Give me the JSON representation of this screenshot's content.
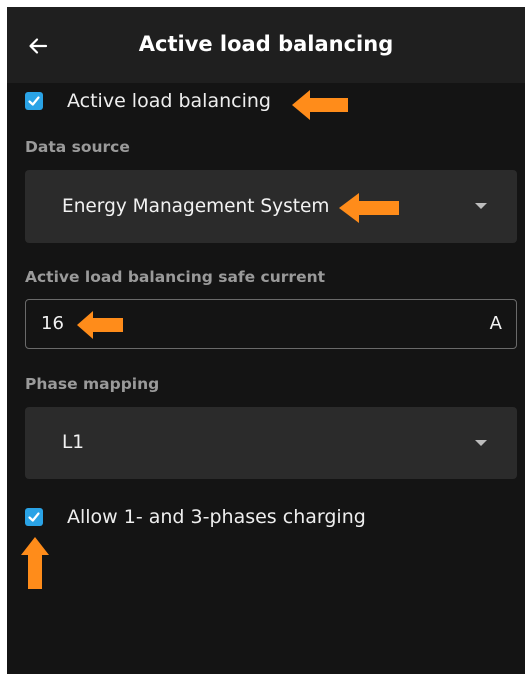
{
  "header": {
    "title": "Active load balancing",
    "back_icon": "arrow-left-icon"
  },
  "active_load_balancing": {
    "label": "Active load balancing",
    "checked": true
  },
  "data_source": {
    "label": "Data source",
    "value": "Energy Management System"
  },
  "safe_current": {
    "label": "Active load balancing safe current",
    "value": "16",
    "unit": "A"
  },
  "phase_mapping": {
    "label": "Phase mapping",
    "value": "L1"
  },
  "allow_phases": {
    "label": "Allow 1- and 3-phases charging",
    "checked": true
  },
  "colors": {
    "background": "#141414",
    "header": "#1f1f1f",
    "field": "#2b2b2b",
    "checkbox": "#2aa3e6",
    "annotation_arrow": "#ff8c1a",
    "section_label": "#9a9a9a"
  }
}
